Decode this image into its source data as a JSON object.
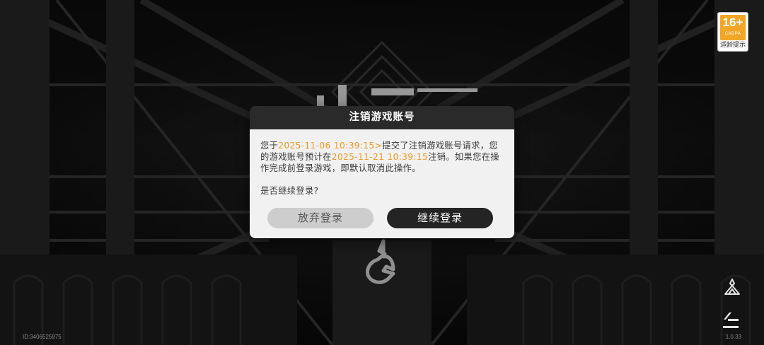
{
  "age_rating": {
    "number": "16+",
    "org": "CADPA",
    "tip": "适龄提示"
  },
  "dialog": {
    "title": "注销游戏账号",
    "msg_part1": "您于",
    "submit_time": "2025-11-06 10:39:15>",
    "msg_part2": "提交了注销游戏账号请求，您的游戏账号预计在",
    "cancel_time": "2025-11-21 10:39:15",
    "msg_part3": "注销。如果您在操作完成前登录游戏，即默认取消此操作。",
    "question": "是否继续登录?",
    "abandon_label": "放弃登录",
    "continue_label": "继续登录"
  },
  "footer": {
    "user_id": "ID:3406525975",
    "version": "1.0.33"
  },
  "icons": {
    "top_side": "character-icon",
    "bottom_side": "upload-icon"
  },
  "colors": {
    "highlight": "#f09a25",
    "badge_orange": "#f3a526"
  }
}
